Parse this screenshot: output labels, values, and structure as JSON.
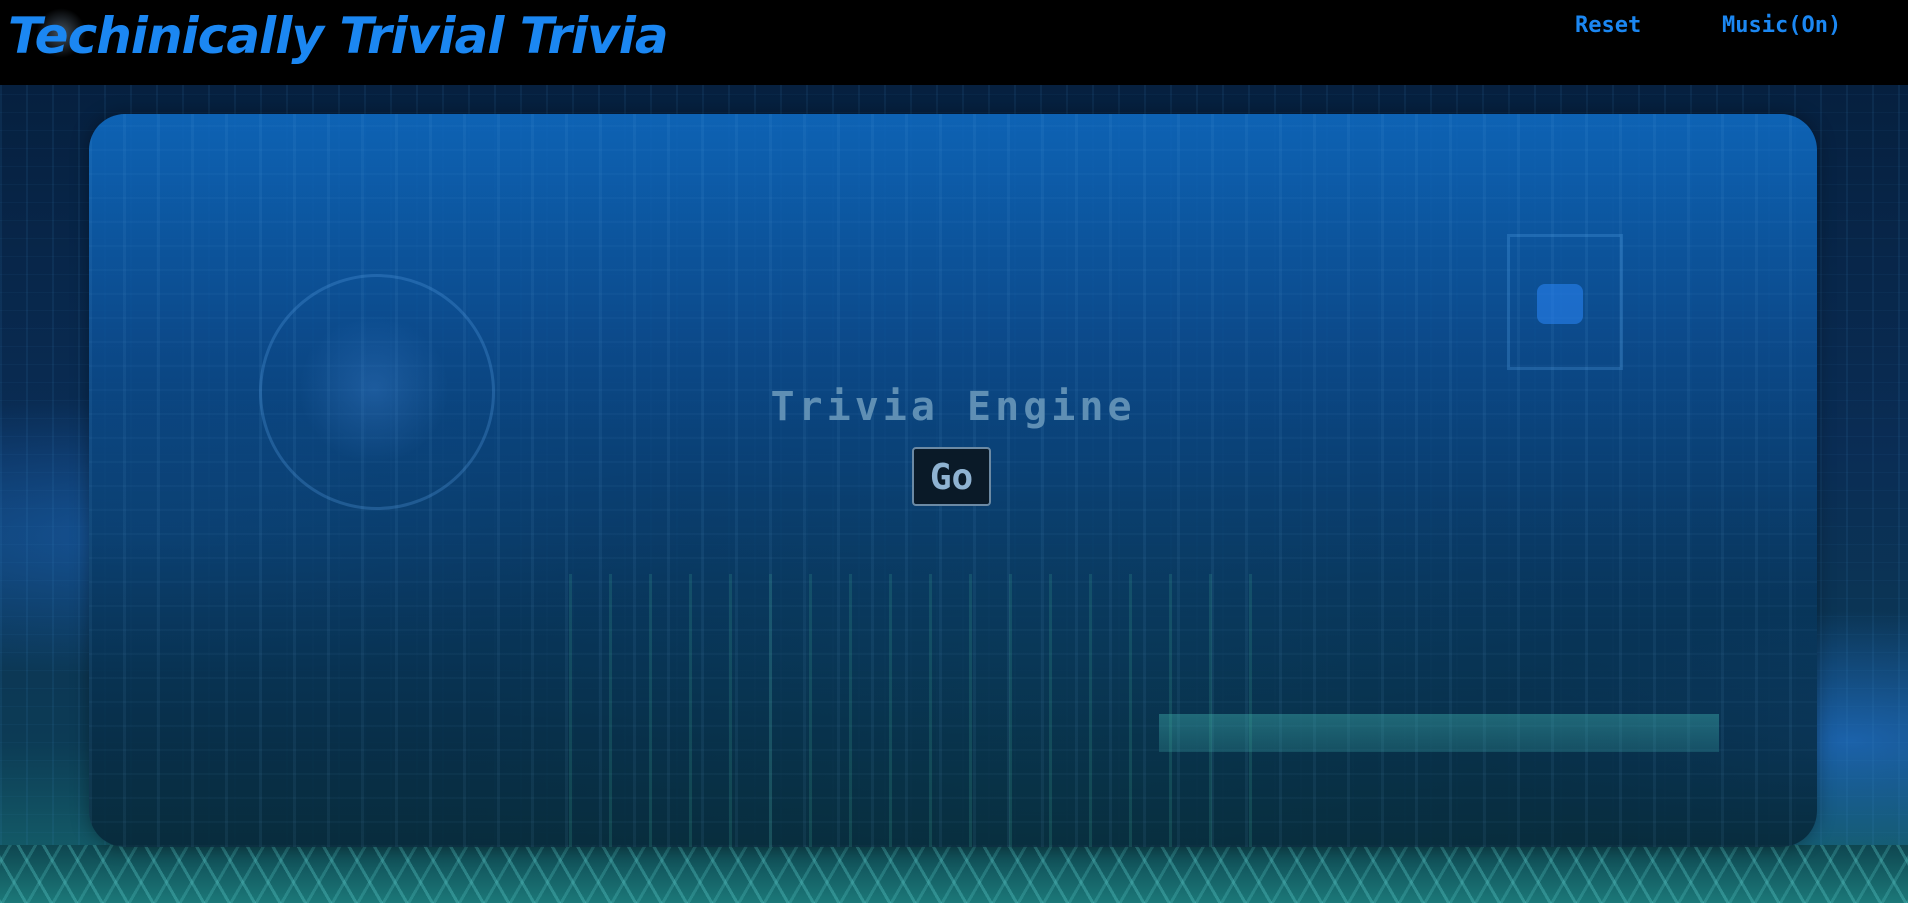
{
  "header": {
    "title": "Techinically Trivial Trivia",
    "nav": {
      "reset_label": "Reset",
      "music_label": "Music(On)"
    }
  },
  "main": {
    "title": "Trivia Engine",
    "go_button_label": "Go"
  },
  "colors": {
    "accent": "#1b87f2",
    "header_bg": "#000000",
    "panel_title": "#5f8fb4",
    "button_bg": "#0a1a28"
  },
  "icons": {
    "background": "circuit-board-image"
  }
}
